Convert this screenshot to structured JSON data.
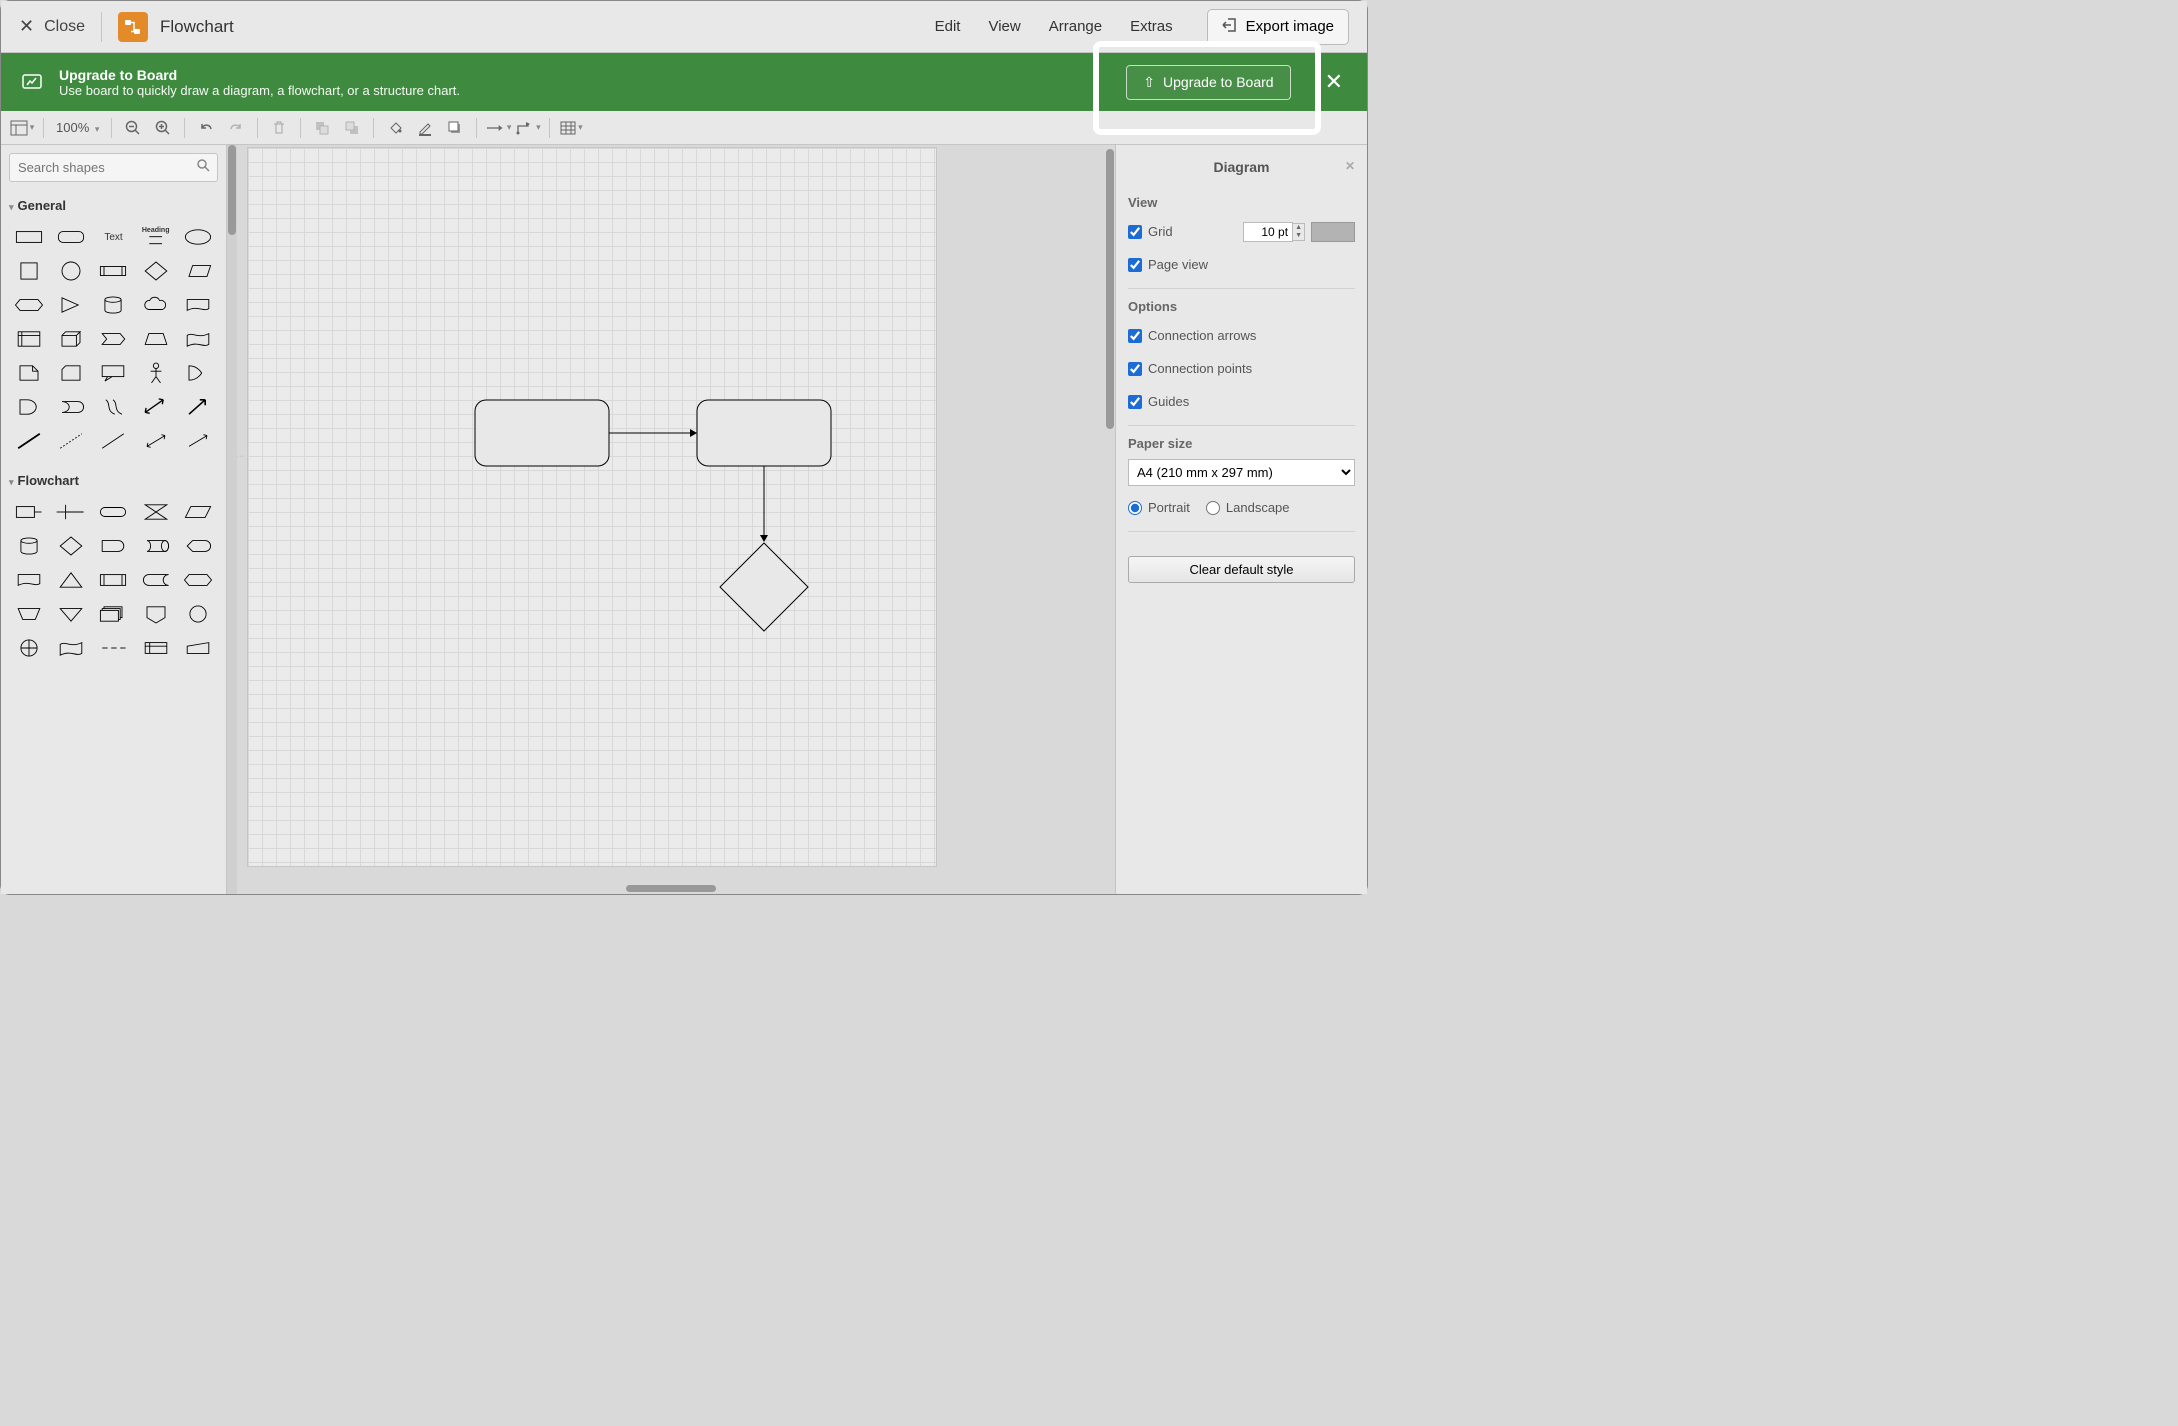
{
  "topbar": {
    "close_label": "Close",
    "title": "Flowchart",
    "menus": [
      "Edit",
      "View",
      "Arrange",
      "Extras"
    ],
    "export_label": "Export image"
  },
  "banner": {
    "title": "Upgrade to Board",
    "subtitle": "Use board to quickly draw a diagram, a flowchart, or a structure chart.",
    "cta": "Upgrade to Board"
  },
  "toolbar": {
    "zoom": "100%"
  },
  "left_panel": {
    "search_placeholder": "Search shapes",
    "sections": {
      "general": "General",
      "flowchart": "Flowchart"
    },
    "text_label": "Text",
    "heading_label": "Heading"
  },
  "right_panel": {
    "title": "Diagram",
    "view_header": "View",
    "grid_label": "Grid",
    "grid_size": "10 pt",
    "page_view_label": "Page view",
    "options_header": "Options",
    "conn_arrows": "Connection arrows",
    "conn_points": "Connection points",
    "guides": "Guides",
    "paper_header": "Paper size",
    "paper_value": "A4 (210 mm x 297 mm)",
    "portrait": "Portrait",
    "landscape": "Landscape",
    "clear_style": "Clear default style"
  }
}
